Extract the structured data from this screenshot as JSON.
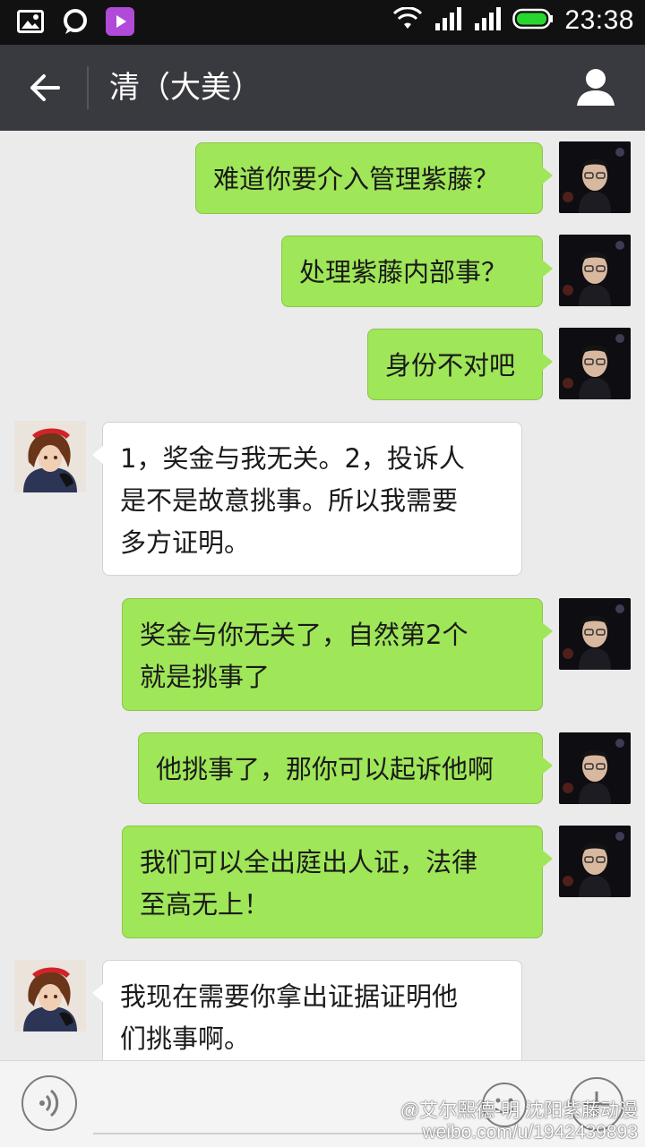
{
  "status_bar": {
    "time": "23:38"
  },
  "header": {
    "title": "清（大美）"
  },
  "messages": [
    {
      "from": "me",
      "lines": [
        "难道你要介入管理紫藤？"
      ]
    },
    {
      "from": "me",
      "lines": [
        "处理紫藤内部事？"
      ]
    },
    {
      "from": "me",
      "lines": [
        "身份不对吧"
      ]
    },
    {
      "from": "them",
      "lines": [
        "1，奖金与我无关。2，投诉人",
        "是不是故意挑事。所以我需要",
        "多方证明。"
      ]
    },
    {
      "from": "me",
      "lines": [
        "奖金与你无关了，自然第2个",
        "就是挑事了"
      ]
    },
    {
      "from": "me",
      "lines": [
        "他挑事了，那你可以起诉他啊"
      ]
    },
    {
      "from": "me",
      "lines": [
        "我们可以全出庭出人证，法律",
        "至高无上！"
      ]
    },
    {
      "from": "them",
      "lines": [
        "我现在需要你拿出证据证明他",
        "们挑事啊。"
      ]
    }
  ],
  "watermark": {
    "line1": "@艾尔熙德-明 沈阳紫藤动漫",
    "line2": "weibo.com/u/1942439893"
  }
}
